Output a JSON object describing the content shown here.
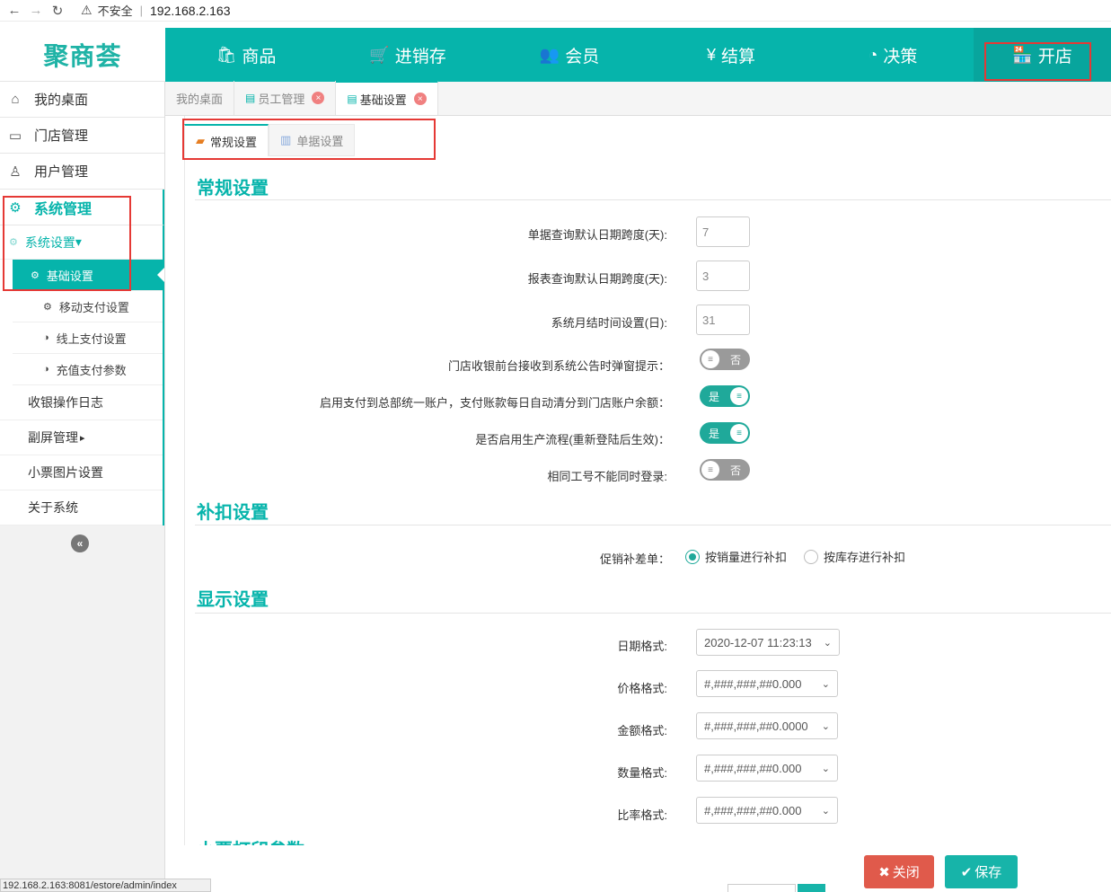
{
  "browser": {
    "back": "←",
    "forward": "→",
    "reload": "↻",
    "warn_icon": "⚠",
    "security_text": "不安全",
    "url": "192.168.2.163",
    "status_url": "192.168.2.163:8081/estore/admin/index"
  },
  "logo": "聚商荟",
  "topnav": [
    {
      "icon": "🛍",
      "icon_name": "bag-icon",
      "label": "商品"
    },
    {
      "icon": "🛒",
      "icon_name": "cart-icon",
      "label": "进销存"
    },
    {
      "icon": "👥",
      "icon_name": "members-icon",
      "label": "会员"
    },
    {
      "icon": "¥",
      "icon_name": "settle-icon",
      "label": "结算"
    },
    {
      "icon": "◔",
      "icon_name": "decision-icon",
      "label": "决策"
    },
    {
      "icon": "🏪",
      "icon_name": "store-icon",
      "label": "开店"
    }
  ],
  "sidebar": {
    "items": [
      {
        "icon": "⌂",
        "label": "我的桌面"
      },
      {
        "icon": "▭",
        "label": "门店管理"
      },
      {
        "icon": "♙",
        "label": "用户管理"
      },
      {
        "icon": "⚙",
        "label": "系统管理"
      }
    ],
    "sub_title": "系统设置",
    "sub_title_caret": "▾",
    "sub_items": [
      {
        "icon": "⚙",
        "label": "基础设置"
      },
      {
        "icon": "⚙",
        "label": "移动支付设置"
      },
      {
        "icon": "◑",
        "label": "线上支付设置"
      },
      {
        "icon": "◑",
        "label": "充值支付参数"
      }
    ],
    "plain_items": [
      "收银操作日志",
      "副屏管理",
      "小票图片设置",
      "关于系统"
    ],
    "plain_caret": "▸",
    "collapse": "«"
  },
  "tabs": [
    {
      "icon": "",
      "label": "我的桌面",
      "close": ""
    },
    {
      "icon": "▤",
      "label": "员工管理",
      "close": "×"
    },
    {
      "icon": "▤",
      "label": "基础设置",
      "close": "×"
    }
  ],
  "subtabs": [
    {
      "icon": "▰",
      "label": "常规设置"
    },
    {
      "icon": "▥",
      "label": "单据设置"
    }
  ],
  "sections": {
    "general": "常规设置",
    "deduct": "补扣设置",
    "display": "显示设置",
    "next": "小票打印参数"
  },
  "general": {
    "query_days_label": "单据查询默认日期跨度(天):",
    "query_days_value": "7",
    "report_days_label": "报表查询默认日期跨度(天):",
    "report_days_value": "3",
    "month_end_label": "系统月结时间设置(日):",
    "month_end_value": "31",
    "notice_popup_label": "门店收银前台接收到系统公告时弹窗提示：",
    "notice_popup_value": "否",
    "hq_account_label": "启用支付到总部统一账户，支付账款每日自动清分到门店账户余额：",
    "hq_account_value": "是",
    "production_label": "是否启用生产流程(重新登陆后生效)：",
    "production_value": "是",
    "same_id_label": "相同工号不能同时登录:",
    "same_id_value": "否",
    "knob_glyph": "≡"
  },
  "deduct": {
    "label": "促销补差单：",
    "options": [
      "按销量进行补扣",
      "按库存进行补扣"
    ],
    "selected": 0
  },
  "display": {
    "date_label": "日期格式:",
    "date_value": "2020-12-07 11:23:13",
    "price_label": "价格格式:",
    "price_value": "#,###,###,##0.000",
    "amount_label": "金额格式:",
    "amount_value": "#,###,###,##0.0000",
    "qty_label": "数量格式:",
    "qty_value": "#,###,###,##0.000",
    "ratio_label": "比率格式:",
    "ratio_value": "#,###,###,##0.000",
    "chevron": "⌄"
  },
  "buttons": {
    "close_icon": "✖",
    "close_label": "关闭",
    "save_icon": "✔",
    "save_label": "保存"
  },
  "colors": {
    "primary": "#06b4ab",
    "danger": "#e05a4b",
    "highlight": "#e53935"
  }
}
